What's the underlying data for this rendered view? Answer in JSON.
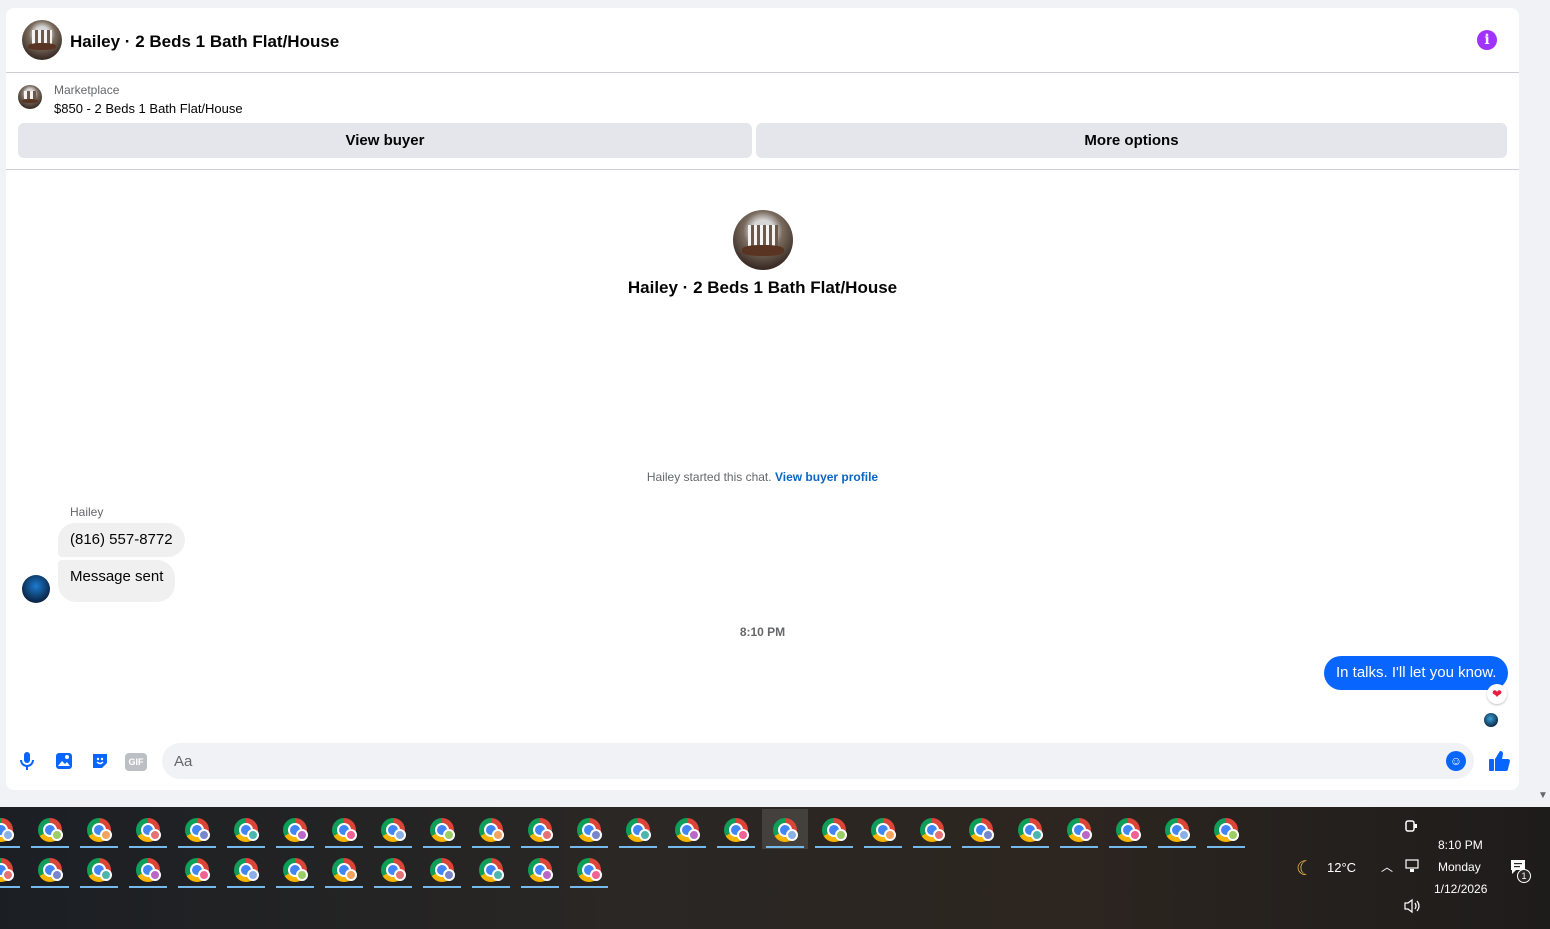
{
  "header": {
    "title": "Hailey · 2 Beds 1 Bath Flat/House",
    "info_icon": "info-icon"
  },
  "marketplace": {
    "label": "Marketplace",
    "item": "$850 - 2 Beds 1 Bath Flat/House",
    "view_buyer_label": "View buyer",
    "more_options_label": "More options"
  },
  "intro": {
    "title": "Hailey · 2 Beds 1 Bath Flat/House"
  },
  "conversation": {
    "started_text": "Hailey started this chat.",
    "buyer_profile_link": "View buyer profile",
    "sender_name": "Hailey",
    "incoming": [
      "(816) 557-8772",
      "Message sent"
    ],
    "time_separator": "8:10 PM",
    "outgoing": "In talks. I'll let you know.",
    "reaction": "❤"
  },
  "composer": {
    "placeholder": "Aa",
    "icons": [
      "microphone-icon",
      "photo-icon",
      "sticker-icon",
      "gif-icon",
      "emoji-icon",
      "thumbs-up-icon"
    ],
    "gif_label": "GIF"
  },
  "taskbar": {
    "weather_temp": "12°C",
    "time": "8:10 PM",
    "day": "Monday",
    "date": "1/12/2026",
    "notification_count": "1",
    "app_rows": [
      {
        "count": 26,
        "active_index": 16
      },
      {
        "count": 13
      }
    ]
  },
  "colors": {
    "accent": "#0866ff",
    "info": "#a033ff",
    "link": "#0a66c2"
  }
}
